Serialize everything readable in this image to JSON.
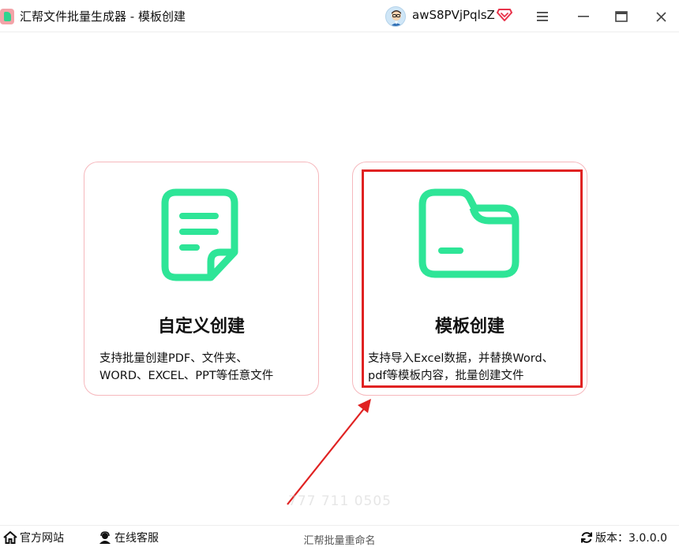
{
  "window": {
    "title": "汇帮文件批量生成器 - 模板创建",
    "username": "awS8PVjPqlsZ",
    "controls": [
      "menu-icon",
      "minimize-icon",
      "maximize-icon",
      "close-icon"
    ]
  },
  "cards": {
    "custom": {
      "title": "自定义创建",
      "desc_line1": "支持批量创建PDF、文件夹、",
      "desc_line2": "WORD、EXCEL、PPT等任意文件",
      "icon": "document-icon"
    },
    "template": {
      "title": "模板创建",
      "desc_line1": "支持导入Excel数据，并替换Word、",
      "desc_line2": "pdf等模板内容，批量创建文件",
      "icon": "folder-icon"
    }
  },
  "watermark": "777 711 0505",
  "statusbar": {
    "website": "官方网站",
    "support": "在线客服",
    "center": "汇帮批量重命名",
    "version": "版本：3.0.0.0"
  },
  "colors": {
    "accent_green": "#2ee597",
    "card_border": "#f6b8bd",
    "highlight_red": "#e02222",
    "vip_red": "#e8344b"
  }
}
